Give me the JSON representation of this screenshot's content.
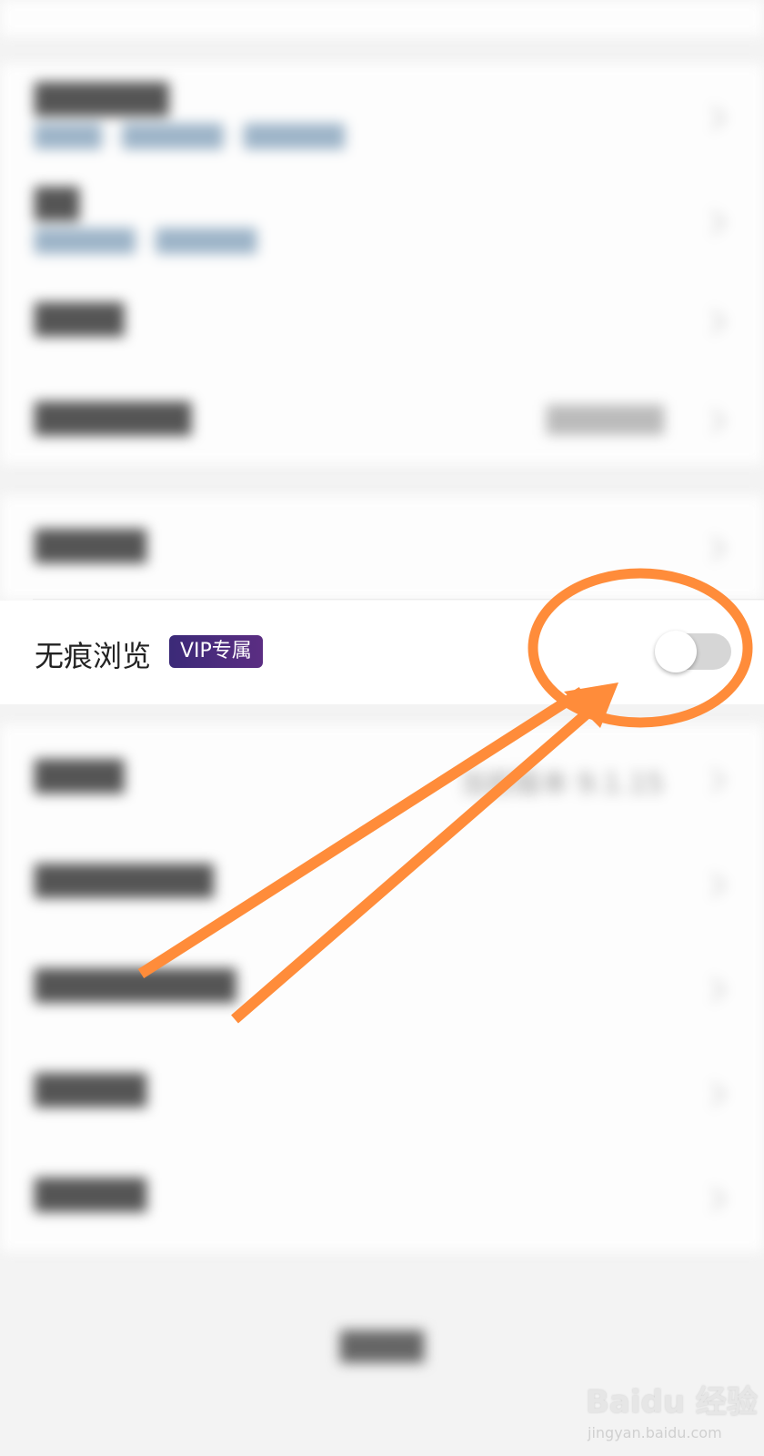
{
  "groups_top": [
    {
      "title": "██████",
      "subtitle": "████ · ██████ · ██████"
    },
    {
      "title": "██",
      "subtitle": "██████ · ██████"
    },
    {
      "title": "████"
    },
    {
      "title": "███████",
      "value": "██████"
    }
  ],
  "group_middle_row": {
    "title": "█████"
  },
  "incognito": {
    "label": "无痕浏览",
    "badge": "VIP专属",
    "enabled": false
  },
  "groups_bottom": [
    {
      "title": "████",
      "value": "当前版本 9.1.15"
    },
    {
      "title": "████████"
    },
    {
      "title": "█████████"
    },
    {
      "title": "█████"
    },
    {
      "title": "█████"
    }
  ],
  "bottom_button": "████",
  "watermark": {
    "brand": "Baidu 经验",
    "url": "jingyan.baidu.com"
  },
  "colors": {
    "annotation": "#ff8c3a",
    "vip_start": "#3b2a78",
    "vip_end": "#5b2d82"
  },
  "icons": {
    "chevron": "chevron-right-icon"
  }
}
